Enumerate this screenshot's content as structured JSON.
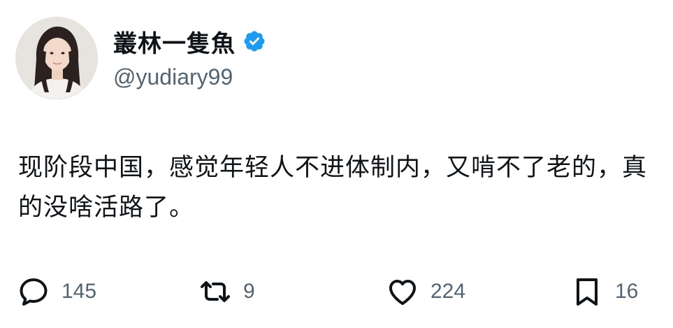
{
  "author": {
    "display_name": "叢林一隻魚",
    "handle": "@yudiary99",
    "verified": true,
    "verified_color": "#1d9bf0"
  },
  "tweet": {
    "text": "现阶段中国，感觉年轻人不进体制内，又啃不了老的，真的没啥活路了。"
  },
  "actions": {
    "reply": {
      "icon": "reply-icon",
      "count": "145"
    },
    "retweet": {
      "icon": "retweet-icon",
      "count": "9"
    },
    "like": {
      "icon": "heart-icon",
      "count": "224"
    },
    "bookmark": {
      "icon": "bookmark-icon",
      "count": "16"
    }
  },
  "colors": {
    "text_primary": "#0f1419",
    "text_secondary": "#536471",
    "background": "#ffffff"
  }
}
